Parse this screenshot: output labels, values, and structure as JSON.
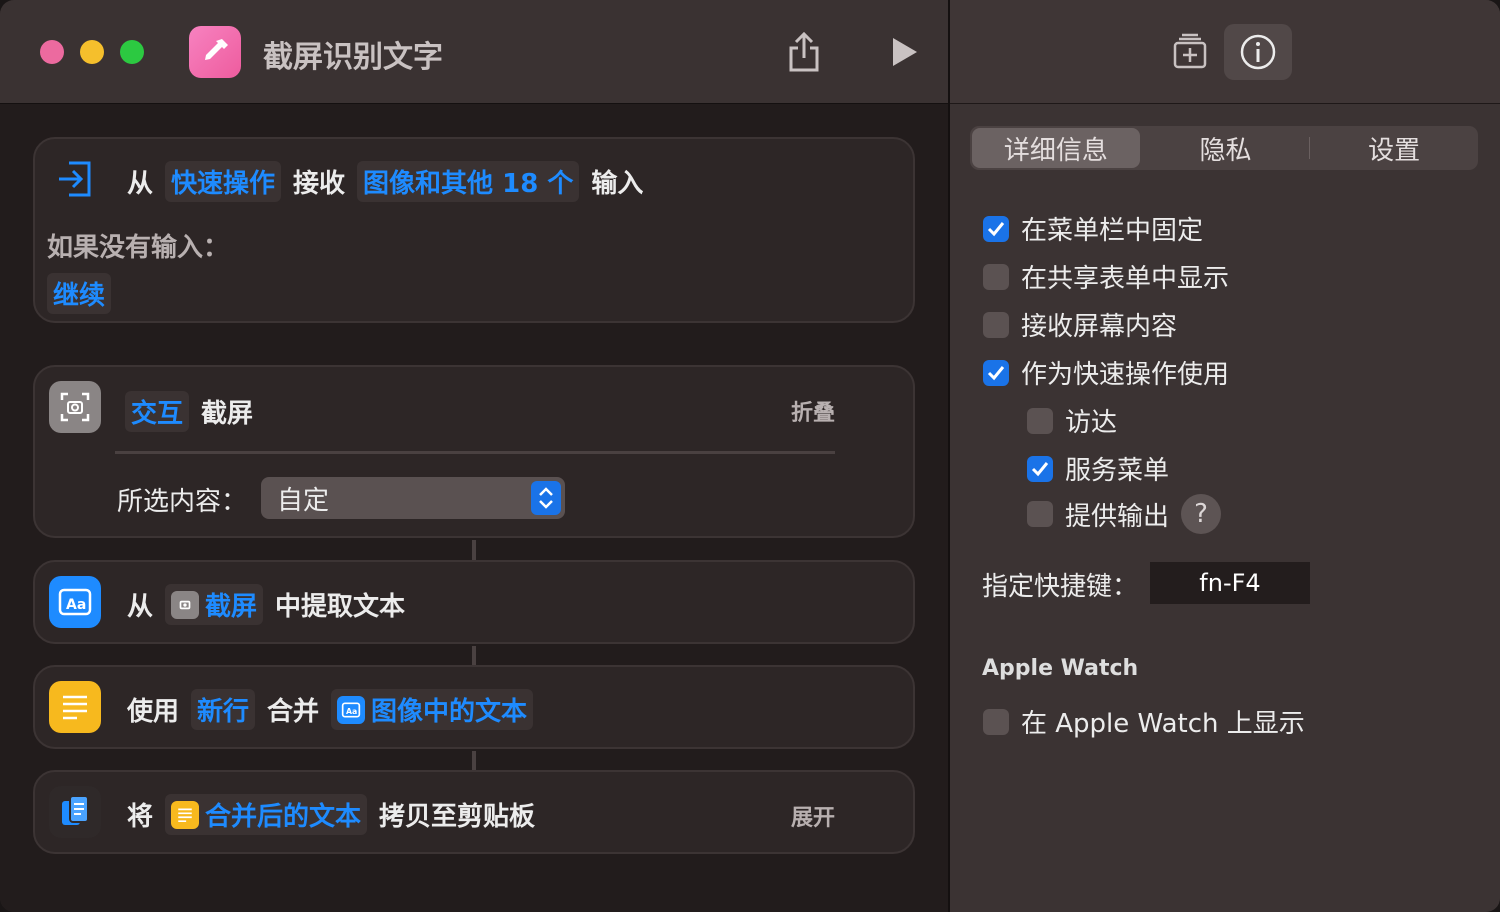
{
  "window": {
    "title": "截屏识别文字",
    "colors": {
      "accent": "#1e8bff",
      "red": "#ec6a9f",
      "yellow": "#f5bf2c",
      "green": "#2cc941"
    },
    "toolbar_icons": [
      "share-icon",
      "play-icon",
      "add-to-library-icon",
      "info-icon"
    ]
  },
  "actions": {
    "receive": {
      "from": "从",
      "source": "快速操作",
      "receive": "接收",
      "types": "图像和其他 18 个",
      "input": "输入",
      "if_none": "如果没有输入：",
      "continue": "继续"
    },
    "screenshot": {
      "mode": "交互",
      "name": "截屏",
      "collapse": "折叠",
      "selection_label": "所选内容：",
      "selection_value": "自定"
    },
    "extract": {
      "from": "从",
      "source": "截屏",
      "action": "中提取文本"
    },
    "combine": {
      "use": "使用",
      "separator": "新行",
      "combine": "合并",
      "source": "图像中的文本"
    },
    "copy": {
      "will": "将",
      "source": "合并后的文本",
      "action": "拷贝至剪贴板",
      "expand": "展开"
    }
  },
  "inspector": {
    "tabs": [
      "详细信息",
      "隐私",
      "设置"
    ],
    "options": [
      {
        "label": "在菜单栏中固定",
        "checked": true
      },
      {
        "label": "在共享表单中显示",
        "checked": false
      },
      {
        "label": "接收屏幕内容",
        "checked": false
      },
      {
        "label": "作为快速操作使用",
        "checked": true
      },
      {
        "label": "访达",
        "checked": false
      },
      {
        "label": "服务菜单",
        "checked": true
      },
      {
        "label": "提供输出",
        "checked": false
      }
    ],
    "help": "?",
    "shortcut_label": "指定快捷键：",
    "shortcut_value": "fn-F4",
    "watch_section": "Apple Watch",
    "watch_option": {
      "label": "在 Apple Watch 上显示",
      "checked": false
    }
  }
}
